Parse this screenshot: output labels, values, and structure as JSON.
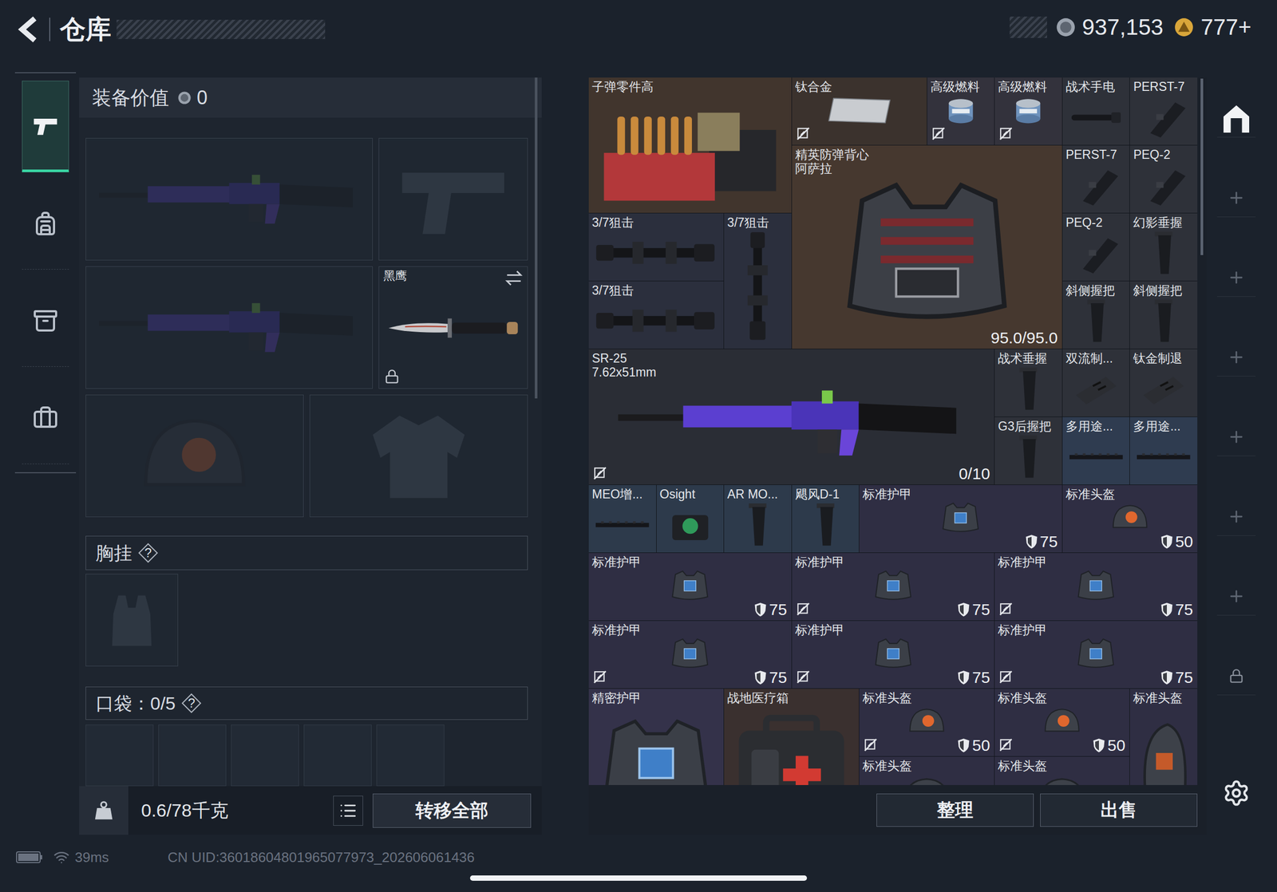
{
  "header": {
    "title": "仓库",
    "currencies": [
      {
        "kind": "coin",
        "amount": "937,153"
      },
      {
        "kind": "gold",
        "amount": "777+"
      }
    ]
  },
  "nav": [
    {
      "kind": "weapons",
      "selected": true
    },
    {
      "kind": "backpack",
      "selected": false
    },
    {
      "kind": "supplies",
      "selected": false
    },
    {
      "kind": "case",
      "selected": false
    }
  ],
  "loadout": {
    "value_label": "装备价值",
    "value": "0",
    "slots": [
      {
        "kind": "rifle",
        "empty": true
      },
      {
        "kind": "pistol",
        "empty": true
      },
      {
        "kind": "rifle",
        "empty": true
      },
      {
        "kind": "knife",
        "empty": false,
        "name": "黑鹰",
        "locked": true
      },
      {
        "kind": "helmet",
        "empty": true
      },
      {
        "kind": "jacket",
        "empty": true
      }
    ],
    "chest_rig": {
      "label": "胸挂",
      "help": "?",
      "empty": true
    },
    "pockets": {
      "label": "口袋：0/5",
      "help": "?",
      "slots": [
        {
          "empty": true
        },
        {
          "empty": true
        },
        {
          "empty": true
        },
        {
          "empty": true
        },
        {
          "empty": true
        }
      ]
    },
    "weight": "0.6/78千克",
    "transfer_button": "转移全部"
  },
  "stash": {
    "items": [
      {
        "name": "子弹零件高",
        "kind": "ammo",
        "color": "#41352d",
        "marked": false
      },
      {
        "name": "钛合金",
        "kind": "material",
        "color": "#3b322d",
        "marked": true
      },
      {
        "name": "高级燃料",
        "kind": "fuel",
        "color": "#33323c",
        "marked": true
      },
      {
        "name": "高级燃料",
        "kind": "fuel",
        "color": "#33323c",
        "marked": true
      },
      {
        "name": "战术手电",
        "kind": "light",
        "color": "#2e3139",
        "marked": false
      },
      {
        "name": "PERST-7",
        "kind": "laser",
        "color": "#2e3139",
        "marked": false
      },
      {
        "name": "精英防弹背心",
        "subname": "阿萨拉",
        "kind": "vest",
        "color": "#46382f",
        "marked": false,
        "badge": "95.0/95.0",
        "shield": false
      },
      {
        "name": "PERST-7",
        "kind": "laser",
        "color": "#2e3139",
        "marked": false
      },
      {
        "name": "PEQ-2",
        "kind": "laser",
        "color": "#2e3139",
        "marked": false
      },
      {
        "name": "3/7狙击",
        "kind": "scope",
        "color": "#2b2f3d",
        "marked": false
      },
      {
        "name": "3/7狙击",
        "kind": "scope-vertical",
        "color": "#2b2f3d",
        "marked": false
      },
      {
        "name": "PEQ-2",
        "kind": "laser",
        "color": "#2e3139",
        "marked": false
      },
      {
        "name": "幻影垂握",
        "kind": "grip",
        "color": "#2e3139",
        "marked": false
      },
      {
        "name": "3/7狙击",
        "kind": "scope",
        "color": "#2b2f3d",
        "marked": false
      },
      {
        "name": "斜侧握把",
        "kind": "grip",
        "color": "#2e3139",
        "marked": false
      },
      {
        "name": "斜侧握把",
        "kind": "grip",
        "color": "#2e3139",
        "marked": false
      },
      {
        "name": "SR-25",
        "subname": "7.62x51mm",
        "kind": "rifle",
        "color": "#2a2d35",
        "marked": true,
        "badge": "0/10",
        "shield": false
      },
      {
        "name": "战术垂握",
        "kind": "grip",
        "color": "#2e3139",
        "marked": false
      },
      {
        "name": "双流制...",
        "kind": "muzzle",
        "color": "#2e3139",
        "marked": false
      },
      {
        "name": "钛金制退",
        "kind": "muzzle",
        "color": "#2e3139",
        "marked": false
      },
      {
        "name": "G3后握把",
        "kind": "grip",
        "color": "#2e3139",
        "marked": false
      },
      {
        "name": "多用途...",
        "kind": "rail",
        "color": "#2f3c50",
        "marked": false
      },
      {
        "name": "多用途...",
        "kind": "rail",
        "color": "#2f3c50",
        "marked": false
      },
      {
        "name": "MEO增...",
        "kind": "rail",
        "color": "#2d3a4b",
        "marked": false
      },
      {
        "name": "Osight",
        "kind": "sight",
        "color": "#2d3a4b",
        "marked": false
      },
      {
        "name": "AR MO...",
        "kind": "grip",
        "color": "#2d3a4b",
        "marked": false
      },
      {
        "name": "飓风D-1",
        "kind": "grip",
        "color": "#2d3a4b",
        "marked": false
      },
      {
        "name": "标准护甲",
        "kind": "armor",
        "color": "#2f2e43",
        "marked": false,
        "badge": "75",
        "shield": true
      },
      {
        "name": "标准头盔",
        "kind": "helmet",
        "color": "#2f2e43",
        "marked": false,
        "badge": "50",
        "shield": true
      },
      {
        "name": "标准护甲",
        "kind": "armor",
        "color": "#2f2e43",
        "marked": false,
        "badge": "75",
        "shield": true
      },
      {
        "name": "标准护甲",
        "kind": "armor",
        "color": "#2f2e43",
        "marked": true,
        "badge": "75",
        "shield": true
      },
      {
        "name": "标准护甲",
        "kind": "armor",
        "color": "#2f2e43",
        "marked": true,
        "badge": "75",
        "shield": true
      },
      {
        "name": "标准护甲",
        "kind": "armor",
        "color": "#2f2e43",
        "marked": true,
        "badge": "75",
        "shield": true
      },
      {
        "name": "标准护甲",
        "kind": "armor",
        "color": "#2f2e43",
        "marked": true,
        "badge": "75",
        "shield": true
      },
      {
        "name": "标准护甲",
        "kind": "armor",
        "color": "#2f2e43",
        "marked": true,
        "badge": "75",
        "shield": true
      },
      {
        "name": "精密护甲",
        "kind": "armor",
        "color": "#34324a",
        "marked": false
      },
      {
        "name": "战地医疗箱",
        "kind": "medkit",
        "color": "#3a302f",
        "marked": false
      },
      {
        "name": "标准头盔",
        "kind": "helmet",
        "color": "#2f2e43",
        "marked": true,
        "badge": "50",
        "shield": true
      },
      {
        "name": "标准头盔",
        "kind": "helmet",
        "color": "#2f2e43",
        "marked": true,
        "badge": "50",
        "shield": true
      },
      {
        "name": "标准头盔",
        "kind": "helmet-side",
        "color": "#2f2e43",
        "marked": false
      },
      {
        "name": "标准头盔",
        "kind": "helmet",
        "color": "#2f2e43",
        "marked": false
      },
      {
        "name": "标准头盔",
        "kind": "helmet",
        "color": "#2f2e43",
        "marked": false
      }
    ],
    "buttons": [
      "整理",
      "出售"
    ]
  },
  "side_actions": [
    {
      "kind": "vault",
      "locked": false
    },
    {
      "kind": "add",
      "locked": false
    },
    {
      "kind": "add",
      "locked": false
    },
    {
      "kind": "add",
      "locked": false
    },
    {
      "kind": "add",
      "locked": false
    },
    {
      "kind": "add",
      "locked": false
    },
    {
      "kind": "add",
      "locked": false
    },
    {
      "kind": "add",
      "locked": true
    }
  ],
  "status_bar": {
    "latency": "39ms",
    "uid": "CN UID:36018604801965077973_202606061436"
  }
}
